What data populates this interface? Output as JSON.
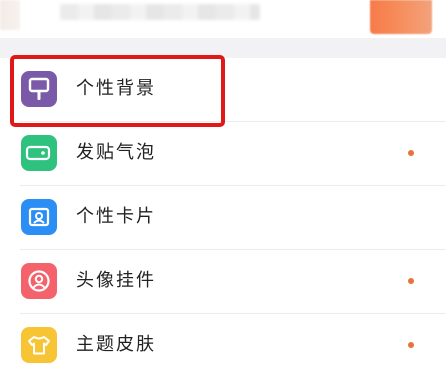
{
  "menu": {
    "items": [
      {
        "label": "个性背景",
        "icon": "paint-roller-icon",
        "icon_color": "#7a5aa8",
        "has_dot": false
      },
      {
        "label": "发贴气泡",
        "icon": "chat-bubble-icon",
        "icon_color": "#2ec27e",
        "has_dot": true
      },
      {
        "label": "个性卡片",
        "icon": "profile-card-icon",
        "icon_color": "#2b8ef5",
        "has_dot": false
      },
      {
        "label": "头像挂件",
        "icon": "avatar-pendant-icon",
        "icon_color": "#f4636b",
        "has_dot": true
      },
      {
        "label": "主题皮肤",
        "icon": "tshirt-icon",
        "icon_color": "#f7c534",
        "has_dot": true
      }
    ]
  },
  "colors": {
    "dot": "#e8713c",
    "highlight": "#e01818",
    "section_gap": "#f2f2f4"
  }
}
